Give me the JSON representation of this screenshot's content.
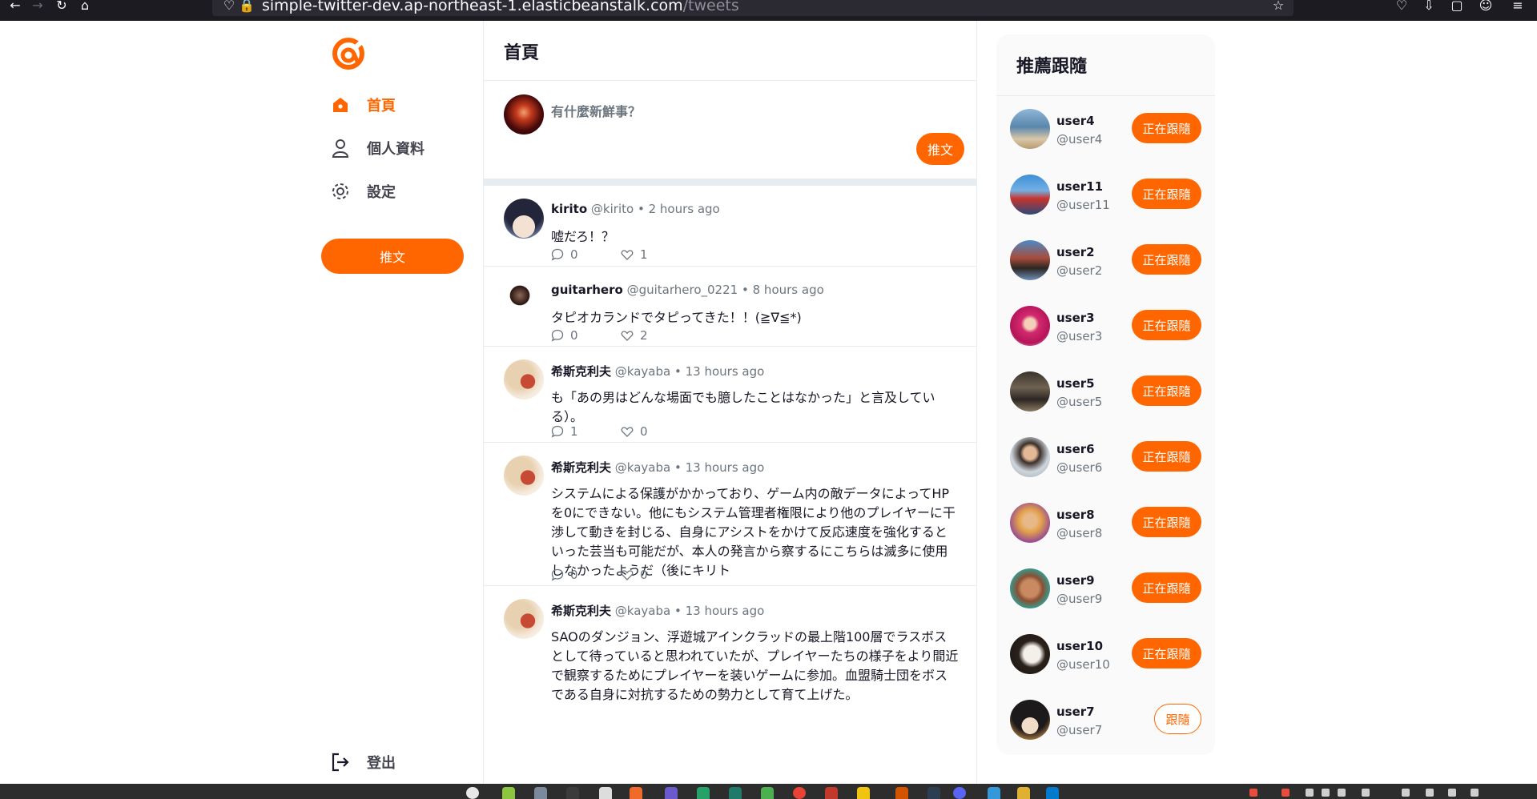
{
  "browser": {
    "url_host": "simple-twitter-dev.ap-northeast-1.elasticbeanstalk.com",
    "url_path": "/tweets"
  },
  "sidebar": {
    "items": [
      {
        "label": "首頁",
        "icon": "home-icon"
      },
      {
        "label": "個人資料",
        "icon": "user-icon"
      },
      {
        "label": "設定",
        "icon": "gear-icon"
      }
    ],
    "tweet_button": "推文",
    "logout": "登出"
  },
  "main": {
    "title": "首頁",
    "composer": {
      "placeholder": "有什麼新鮮事？",
      "button": "推文"
    },
    "tweets": [
      {
        "name": "kirito",
        "handle": "@kirito",
        "time": "2 hours ago",
        "text": "嘘だろ！？",
        "replies": "0",
        "likes": "1"
      },
      {
        "name": "guitarhero",
        "handle": "@guitarhero_0221",
        "time": "8 hours ago",
        "text": "タピオカランドでタピってきた！！(≧∇≦*)",
        "replies": "0",
        "likes": "2"
      },
      {
        "name": "希斯克利夫",
        "handle": "@kayaba",
        "time": "13 hours ago",
        "text": "も「あの男はどんな場面でも臆したことはなかった」と言及している）。",
        "replies": "1",
        "likes": "0"
      },
      {
        "name": "希斯克利夫",
        "handle": "@kayaba",
        "time": "13 hours ago",
        "text": "システムによる保護がかかっており、ゲーム内の敵データによってHPを0にできない。他にもシステム管理者権限により他のプレイヤーに干渉して動きを封じる、自身にアシストをかけて反応速度を強化するといった芸当も可能だが、本人の発言から察するにこちらは滅多に使用しなかったようだ（後にキリト",
        "replies": "0",
        "likes": "0"
      },
      {
        "name": "希斯克利夫",
        "handle": "@kayaba",
        "time": "13 hours ago",
        "text": "SAOのダンジョン、浮遊城アインクラッドの最上階100層でラスボスとして待っていると思われていたが、プレイヤーたちの様子をより間近で観察するためにプレイヤーを装いゲームに参加。血盟騎士団をボスである自身に対抗するための勢力として育て上げた。",
        "replies": "",
        "likes": ""
      }
    ]
  },
  "recommend": {
    "title": "推薦跟隨",
    "following_label": "正在跟隨",
    "follow_label": "跟隨",
    "users": [
      {
        "name": "user4",
        "handle": "@user4",
        "following": true
      },
      {
        "name": "user11",
        "handle": "@user11",
        "following": true
      },
      {
        "name": "user2",
        "handle": "@user2",
        "following": true
      },
      {
        "name": "user3",
        "handle": "@user3",
        "following": true
      },
      {
        "name": "user5",
        "handle": "@user5",
        "following": true
      },
      {
        "name": "user6",
        "handle": "@user6",
        "following": true
      },
      {
        "name": "user8",
        "handle": "@user8",
        "following": true
      },
      {
        "name": "user9",
        "handle": "@user9",
        "following": true
      },
      {
        "name": "user10",
        "handle": "@user10",
        "following": true
      },
      {
        "name": "user7",
        "handle": "@user7",
        "following": false
      }
    ]
  },
  "colors": {
    "accent": "#ff6600",
    "text": "#171725",
    "muted": "#6c757d",
    "divider": "#e6ecf0"
  }
}
